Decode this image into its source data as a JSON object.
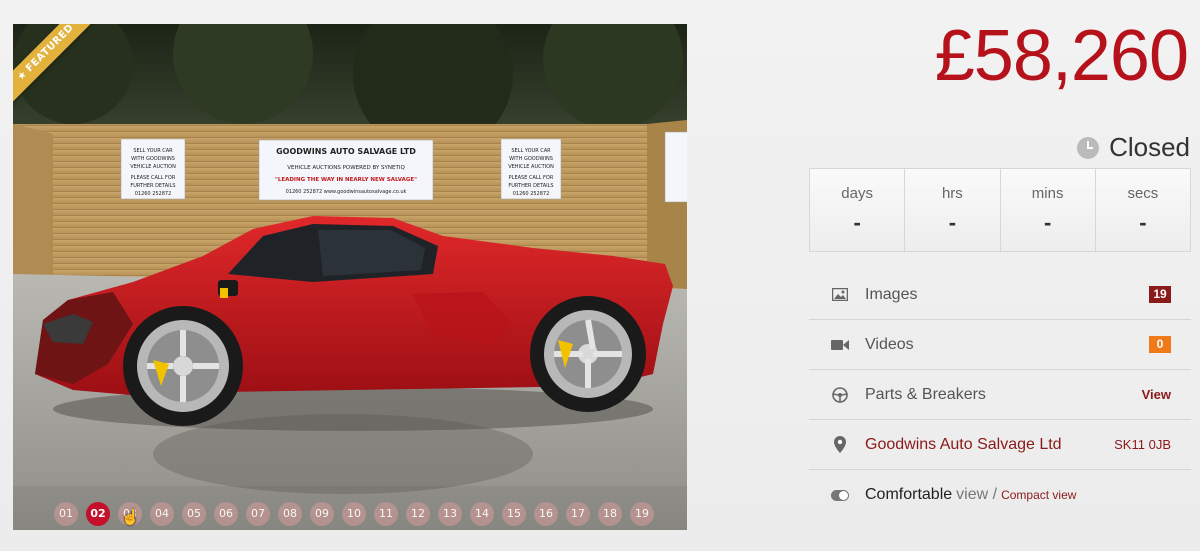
{
  "gallery": {
    "featured_label": "FEATURED",
    "thumbnails": [
      "01",
      "02",
      "03",
      "04",
      "05",
      "06",
      "07",
      "08",
      "09",
      "10",
      "11",
      "12",
      "13",
      "14",
      "15",
      "16",
      "17",
      "18",
      "19"
    ],
    "active_index": 1,
    "signs": {
      "main_title": "GOODWINS AUTO SALVAGE LTD",
      "main_line1": "VEHICLE AUCTIONS POWERED BY SYNETIQ",
      "main_line2": "\"LEADING THE WAY IN NEARLY NEW SALVAGE\"",
      "main_line3": "01260 252872    www.goodwinsautosalvage.co.uk",
      "side_line1": "SELL YOUR CAR",
      "side_line2": "WITH GOODWINS",
      "side_line3": "VEHICLE AUCTION",
      "side_line4": "PLEASE CALL FOR",
      "side_line5": "FURTHER DETAILS",
      "side_line6": "01260 252872"
    }
  },
  "price": "£58,260",
  "status": "Closed",
  "countdown": [
    {
      "label": "days",
      "value": "-"
    },
    {
      "label": "hrs",
      "value": "-"
    },
    {
      "label": "mins",
      "value": "-"
    },
    {
      "label": "secs",
      "value": "-"
    }
  ],
  "info": {
    "images": {
      "label": "Images",
      "count": "19"
    },
    "videos": {
      "label": "Videos",
      "count": "0"
    },
    "parts": {
      "label": "Parts & Breakers",
      "action": "View"
    },
    "seller": {
      "label": "Goodwins Auto Salvage Ltd",
      "postcode": "SK11 0JB"
    },
    "view_mode": {
      "current": "Comfortable",
      "view_word": "view /",
      "alternate": "Compact view"
    }
  },
  "colors": {
    "accent": "#b5121b",
    "link": "#8b1a1a",
    "badge_red": "#8b1a1a",
    "badge_orange": "#f07a1a"
  }
}
